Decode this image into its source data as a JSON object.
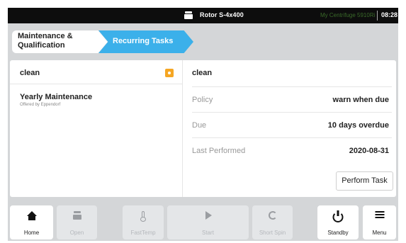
{
  "status_bar": {
    "rotor_icon": "rotor-icon",
    "rotor": "Rotor S-4x400",
    "device_name": "My Centrifuge 5910Ri",
    "time": "08:28"
  },
  "breadcrumb": {
    "items": [
      {
        "label": "Maintenance & Qualification"
      },
      {
        "label": "Recurring Tasks"
      }
    ],
    "active_color": "#3bb0ea"
  },
  "task_list": {
    "items": [
      {
        "label": "clean",
        "badge_icon": "warning-badge-icon",
        "badge_color": "#f5a623"
      }
    ],
    "group": {
      "title": "Yearly Maintenance",
      "subtitle": "Offered by Eppendorf"
    }
  },
  "detail": {
    "title": "clean",
    "rows": [
      {
        "key": "Policy",
        "value": "warn when due"
      },
      {
        "key": "Due",
        "value": "10 days overdue"
      },
      {
        "key": "Last Performed",
        "value": "2020-08-31"
      }
    ],
    "action_label": "Perform Task"
  },
  "toolbar": {
    "buttons": [
      {
        "label": "Home",
        "icon": "home-icon",
        "enabled": true
      },
      {
        "label": "Open",
        "icon": "open-lid-icon",
        "enabled": false
      },
      {
        "label": "FastTemp",
        "icon": "thermometer-icon",
        "enabled": false
      },
      {
        "label": "Start",
        "icon": "play-icon",
        "enabled": false
      },
      {
        "label": "Short Spin",
        "icon": "short-spin-icon",
        "enabled": false
      },
      {
        "label": "Standby",
        "icon": "power-icon",
        "enabled": true
      },
      {
        "label": "Menu",
        "icon": "menu-icon",
        "enabled": true
      }
    ]
  }
}
